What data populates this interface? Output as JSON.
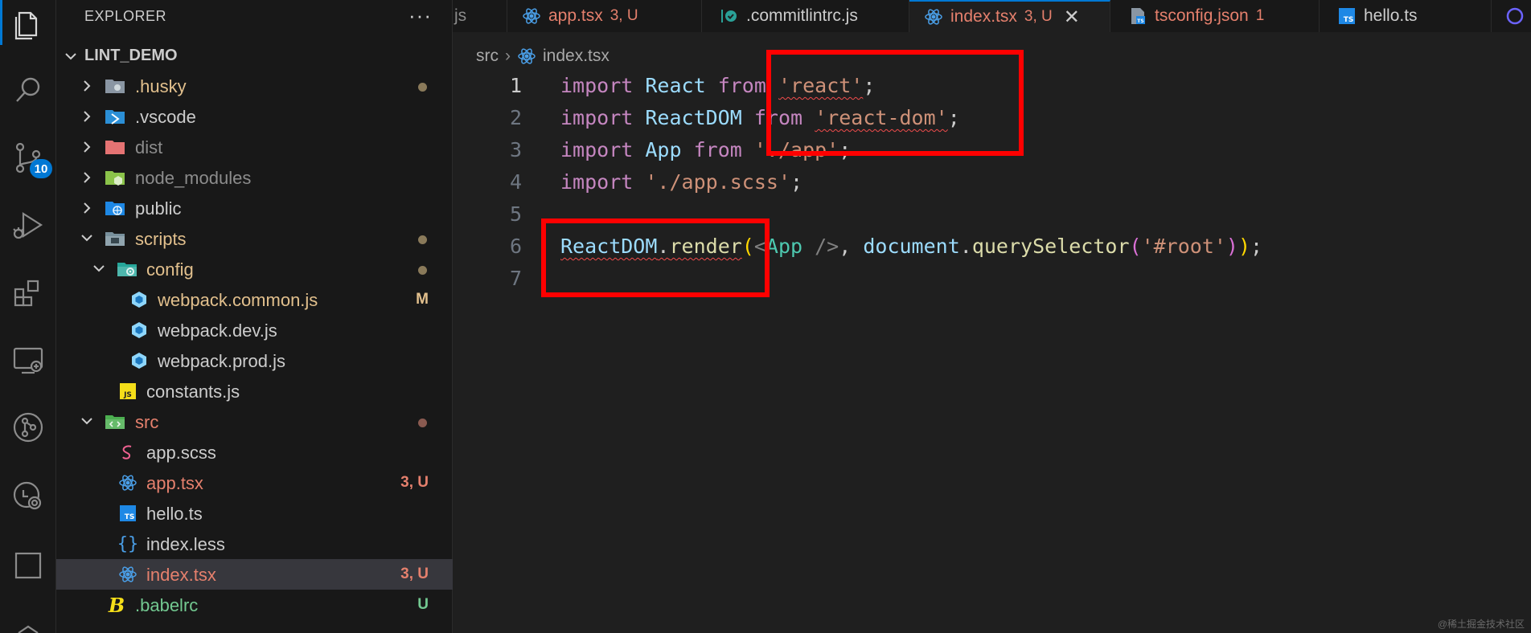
{
  "activity_bar": {
    "items": [
      {
        "name": "explorer-icon"
      },
      {
        "name": "search-icon"
      },
      {
        "name": "source-control-icon",
        "badge": "10"
      },
      {
        "name": "run-debug-icon"
      },
      {
        "name": "extensions-icon"
      },
      {
        "name": "remote-explorer-icon"
      },
      {
        "name": "git-graph-icon"
      },
      {
        "name": "timeline-icon"
      },
      {
        "name": "square-icon"
      },
      {
        "name": "bottom-icon"
      }
    ]
  },
  "sidebar": {
    "title": "EXPLORER",
    "more": "···",
    "project": "LINT_DEMO",
    "tree": [
      {
        "label": ".husky",
        "status": "",
        "dot": true
      },
      {
        "label": ".vscode",
        "status": ""
      },
      {
        "label": "dist",
        "status": ""
      },
      {
        "label": "node_modules",
        "status": ""
      },
      {
        "label": "public",
        "status": ""
      },
      {
        "label": "scripts",
        "status": "",
        "dot": true
      },
      {
        "label": "config",
        "status": "",
        "dot": true
      },
      {
        "label": "webpack.common.js",
        "status": "M"
      },
      {
        "label": "webpack.dev.js",
        "status": ""
      },
      {
        "label": "webpack.prod.js",
        "status": ""
      },
      {
        "label": "constants.js",
        "status": ""
      },
      {
        "label": "src",
        "status": "",
        "dot": true
      },
      {
        "label": "app.scss",
        "status": ""
      },
      {
        "label": "app.tsx",
        "status": "3, U"
      },
      {
        "label": "hello.ts",
        "status": ""
      },
      {
        "label": "index.less",
        "status": ""
      },
      {
        "label": "index.tsx",
        "status": "3, U"
      },
      {
        "label": ".babelrc",
        "status": "U"
      }
    ]
  },
  "tabs": [
    {
      "label": "js",
      "status": ""
    },
    {
      "label": "app.tsx",
      "status": "3, U"
    },
    {
      "label": ".commitlintrc.js",
      "status": ""
    },
    {
      "label": "index.tsx",
      "status": "3, U",
      "close": "✕"
    },
    {
      "label": "tsconfig.json",
      "status": "1"
    },
    {
      "label": "hello.ts",
      "status": ""
    }
  ],
  "breadcrumb": {
    "folder": "src",
    "file": "index.tsx"
  },
  "editor": {
    "line_numbers": [
      "1",
      "2",
      "3",
      "4",
      "5",
      "6",
      "7"
    ],
    "lines": {
      "l1": {
        "kw1": "import",
        "id": "React",
        "kw2": "from",
        "str": "'react'",
        "semi": ";"
      },
      "l2": {
        "kw1": "import",
        "id": "ReactDOM",
        "kw2": "from",
        "str": "'react-dom'",
        "semi": ";"
      },
      "l3": {
        "kw1": "import",
        "id": "App",
        "kw2": "from",
        "str": "'./app'",
        "semi": ";"
      },
      "l4": {
        "kw1": "import",
        "str": "'./app.scss'",
        "semi": ";"
      },
      "l6": {
        "obj": "ReactDOM",
        "dot": ".",
        "fn": "render",
        "open": "(",
        "lt": "<",
        "tag": "App",
        "selfclose": " />",
        "comma": ", ",
        "doc": "document",
        "dot2": ".",
        "fn2": "querySelector",
        "open2": "(",
        "arg": "'#root'",
        "close2": ")",
        "close": ")",
        "semi": ";"
      }
    }
  },
  "watermark": "@稀土掘金技术社区",
  "colors": {
    "accent": "#0078d4",
    "highlight_box": "#ff0000",
    "untracked": "#e5806d",
    "modified": "#e2c08d",
    "added": "#73c991"
  }
}
